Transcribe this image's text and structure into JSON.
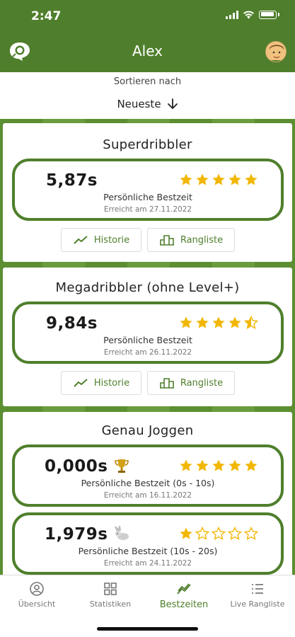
{
  "status": {
    "time": "2:47"
  },
  "header": {
    "title": "Alex"
  },
  "sort": {
    "label": "Sortieren nach",
    "value": "Neueste"
  },
  "colors": {
    "brand": "#4f7f2c",
    "star": "#f2b705",
    "star_empty": "#f2b705"
  },
  "sections": [
    {
      "title": "Superdribbler",
      "records": [
        {
          "time": "5,87s",
          "stars": 5,
          "label": "Persönliche Bestzeit",
          "date": "Erreicht am 27.11.2022"
        }
      ],
      "buttons": {
        "history": "Historie",
        "ranking": "Rangliste"
      }
    },
    {
      "title": "Megadribbler (ohne Level+)",
      "records": [
        {
          "time": "9,84s",
          "stars": 4.5,
          "label": "Persönliche Bestzeit",
          "date": "Erreicht am 26.11.2022"
        }
      ],
      "buttons": {
        "history": "Historie",
        "ranking": "Rangliste"
      }
    },
    {
      "title": "Genau Joggen",
      "records": [
        {
          "time": "0,000s",
          "icon": "trophy-icon",
          "stars": 5,
          "label": "Persönliche Bestzeit (0s - 10s)",
          "date": "Erreicht am 16.11.2022"
        },
        {
          "time": "1,979s",
          "icon": "rabbit-icon",
          "stars": 1,
          "label": "Persönliche Bestzeit (10s - 20s)",
          "date": "Erreicht am 24.11.2022"
        }
      ]
    }
  ],
  "nav": [
    {
      "label": "Übersicht",
      "icon": "user-circle-icon"
    },
    {
      "label": "Statistiken",
      "icon": "grid-icon"
    },
    {
      "label": "Bestzeiten",
      "icon": "trend-icon",
      "active": true
    },
    {
      "label": "Live Rangliste",
      "icon": "list-icon"
    }
  ]
}
